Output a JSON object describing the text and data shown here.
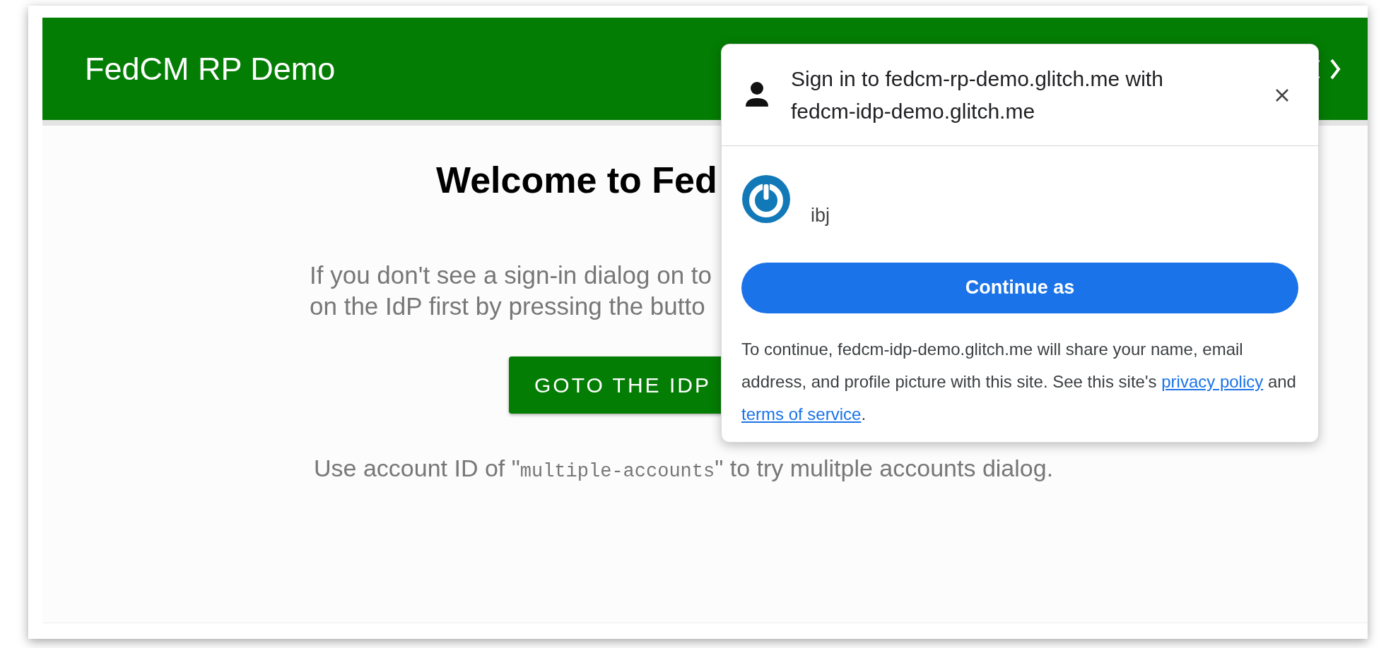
{
  "header": {
    "title": "FedCM RP Demo"
  },
  "main": {
    "heading": "Welcome to Fed",
    "instructions": [
      "If you don't see a sign-in dialog on to",
      "on the IdP first by pressing the butto"
    ],
    "button": "GOTO THE IDP",
    "hint": {
      "before": "Use account ID of \"",
      "code": "multiple-accounts",
      "after": "\" to try mulitple accounts dialog."
    }
  },
  "dialog": {
    "title_lines": [
      "Sign in to fedcm-rp-demo.glitch.me with",
      "fedcm-idp-demo.glitch.me"
    ],
    "account": {
      "name": "ibj"
    },
    "button": "Continue as",
    "disclosure": {
      "before": "To continue, fedcm-idp-demo.glitch.me will share your name, email address, and profile picture with this site. See this site's",
      "links": [
        "privacy policy",
        "terms of service"
      ],
      "between": "and",
      "after": "."
    }
  }
}
